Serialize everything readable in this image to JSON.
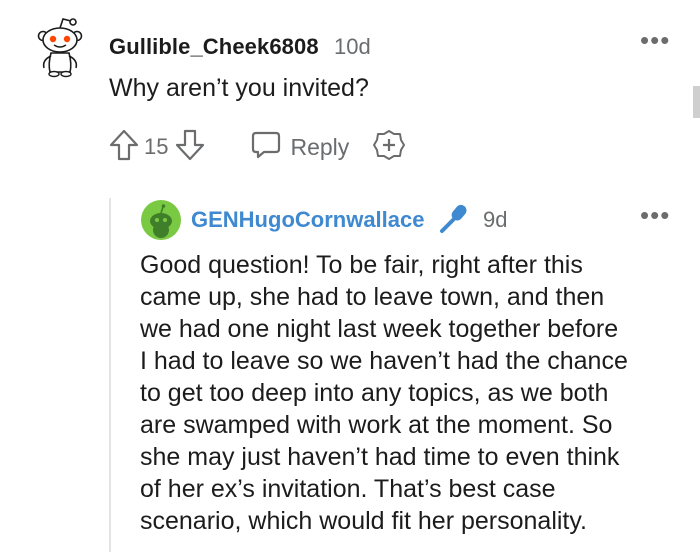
{
  "comment": {
    "username": "Gullible_Cheek6808",
    "age": "10d",
    "body": "Why aren’t you invited?",
    "vote_count": "15",
    "reply_label": "Reply",
    "more_label": "•••"
  },
  "reply": {
    "username": "GENHugoCornwallace",
    "age": "9d",
    "more_label": "•••",
    "body_lines": [
      "Good question! To be fair, right after this",
      "came up, she had to leave town, and then",
      "we had one night last week together before",
      "I had to leave so we haven’t had the chance",
      "to get too deep into any topics, as we both",
      "are swamped with work at the moment. So",
      "she may just haven’t had time to even think",
      "of her ex’s invitation. That’s best case",
      "scenario, which would fit her personality."
    ]
  },
  "colors": {
    "username_link": "#3f89d0",
    "muted": "#6a6c6e",
    "avatar_green": "#7ac943",
    "mic_blue": "#3f89d0"
  },
  "icons": [
    "snoo-avatar-icon",
    "more-options-icon",
    "upvote-icon",
    "downvote-icon",
    "reply-bubble-icon",
    "add-award-icon",
    "green-snoo-avatar-icon",
    "microphone-flair-icon"
  ]
}
